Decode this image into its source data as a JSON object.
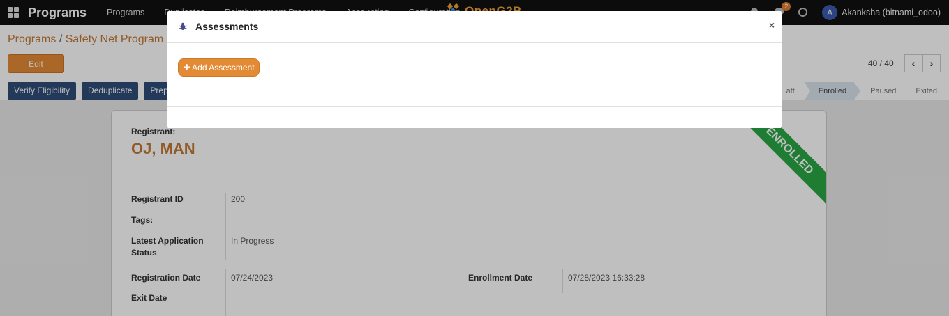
{
  "navbar": {
    "brand": "Programs",
    "menu": [
      "Programs",
      "Duplicates",
      "Reimbursement Programs",
      "Accounting",
      "Configuration"
    ],
    "logo_text": "OpenG2P",
    "notification_count": "2",
    "avatar_letter": "A",
    "username": "Akanksha (bitnami_odoo)"
  },
  "control": {
    "breadcrumb_parent": "Programs",
    "breadcrumb_separator": "/",
    "breadcrumb_current": "Safety Net Program",
    "edit_label": "Edit",
    "pager_text": "40 / 40",
    "action_buttons": [
      "Verify Eligibility",
      "Deduplicate",
      "Prepa"
    ],
    "statuses": [
      "aft",
      "Enrolled",
      "Paused",
      "Exited"
    ],
    "active_status": "Enrolled"
  },
  "sheet": {
    "registrant_label": "Registrant:",
    "registrant_name": "OJ, MAN",
    "ribbon_text": "ENROLLED",
    "registrant_id_label": "Registrant ID",
    "registrant_id_value": "200",
    "tags_label": "Tags:",
    "latest_status_label_1": "Latest Application",
    "latest_status_label_2": "Status",
    "latest_status_value": "In Progress",
    "registration_date_label": "Registration Date",
    "registration_date_value": "07/24/2023",
    "enrollment_date_label": "Enrollment Date",
    "enrollment_date_value": "07/28/2023 16:33:28",
    "exit_date_label": "Exit Date"
  },
  "modal": {
    "title": "Assessments",
    "close_glyph": "×",
    "add_button_label": "Add Assessment"
  },
  "colors": {
    "accent": "#e38a34",
    "navbar": "#111111",
    "action_button": "#2f4c78",
    "ribbon": "#28a745"
  }
}
